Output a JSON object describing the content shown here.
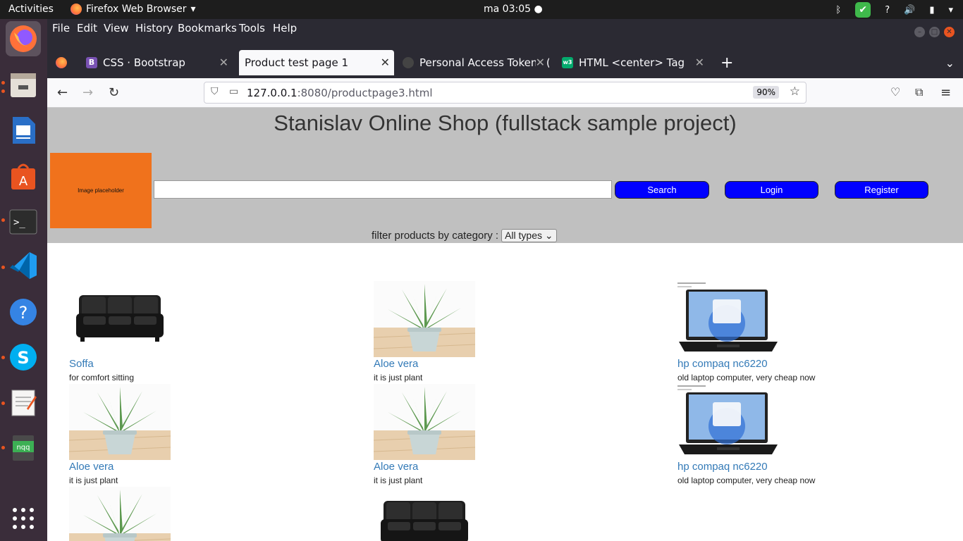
{
  "system": {
    "activities": "Activities",
    "app_name": "Firefox Web Browser",
    "clock": "ma 03:05",
    "help_icon": "?"
  },
  "browser": {
    "menu": [
      "File",
      "Edit",
      "View",
      "History",
      "Bookmarks",
      "Tools",
      "Help"
    ],
    "tabs": [
      {
        "label": "CSS · Bootstrap",
        "favicon": "B"
      },
      {
        "label": "Product test page 1",
        "favicon": ""
      },
      {
        "label": "Personal Access Tokens (",
        "favicon": ""
      },
      {
        "label": "HTML <center> Tag",
        "favicon": ""
      }
    ],
    "url_host": "127.0.0.1",
    "url_rest": ":8080/productpage3.html",
    "zoom": "90%"
  },
  "page": {
    "title": "Stanislav Online Shop (fullstack sample project)",
    "logo_text": "Image placeholder",
    "search_value": "",
    "search_label": "Search",
    "login_label": "Login",
    "register_label": "Register",
    "filter_label": "filter products by category :",
    "filter_selected": "All types"
  },
  "products": [
    {
      "name": "Soffa",
      "desc": "for comfort sitting",
      "image": "sofa"
    },
    {
      "name": "Aloe vera",
      "desc": "it is just plant",
      "image": "aloe"
    },
    {
      "name": "hp compaq nc6220",
      "desc": "old laptop computer, very cheap now",
      "image": "laptop"
    },
    {
      "name": "Aloe vera",
      "desc": "it is just plant",
      "image": "aloe"
    },
    {
      "name": "Aloe vera",
      "desc": "it is just plant",
      "image": "aloe"
    },
    {
      "name": "hp compaq nc6220",
      "desc": "old laptop computer, very cheap now",
      "image": "laptop"
    },
    {
      "name": "",
      "desc": "",
      "image": "aloe"
    },
    {
      "name": "",
      "desc": "",
      "image": "sofa"
    }
  ],
  "colors": {
    "header_bg": "#c0c0c0",
    "logo_bg": "#f0721c",
    "button_bg": "#0000ff",
    "link": "#337ab7"
  }
}
